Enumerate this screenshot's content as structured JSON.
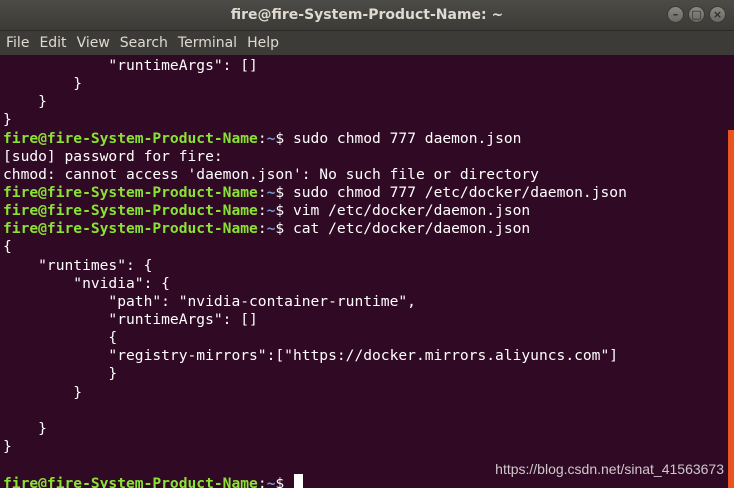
{
  "window": {
    "title": "fire@fire-System-Product-Name: ~",
    "buttons": [
      "close-icon",
      "minimize-icon",
      "maximize-icon"
    ]
  },
  "menu": [
    "File",
    "Edit",
    "View",
    "Search",
    "Terminal",
    "Help"
  ],
  "terminal": {
    "lines": [
      {
        "type": "text",
        "text": "            \"runtimeArgs\": []"
      },
      {
        "type": "text",
        "text": "        }"
      },
      {
        "type": "text",
        "text": "    }"
      },
      {
        "type": "text",
        "text": "}"
      },
      {
        "type": "cmd",
        "user": "fire@fire-System-Product-Name",
        "path": "~",
        "sym": "$ ",
        "cmd": "sudo chmod 777 daemon.json"
      },
      {
        "type": "text",
        "text": "[sudo] password for fire:"
      },
      {
        "type": "text",
        "text": "chmod: cannot access 'daemon.json': No such file or directory"
      },
      {
        "type": "cmd",
        "user": "fire@fire-System-Product-Name",
        "path": "~",
        "sym": "$ ",
        "cmd": "sudo chmod 777 /etc/docker/daemon.json"
      },
      {
        "type": "cmd",
        "user": "fire@fire-System-Product-Name",
        "path": "~",
        "sym": "$ ",
        "cmd": "vim /etc/docker/daemon.json"
      },
      {
        "type": "cmd",
        "user": "fire@fire-System-Product-Name",
        "path": "~",
        "sym": "$ ",
        "cmd": "cat /etc/docker/daemon.json"
      },
      {
        "type": "text",
        "text": "{"
      },
      {
        "type": "text",
        "text": "    \"runtimes\": {"
      },
      {
        "type": "text",
        "text": "        \"nvidia\": {"
      },
      {
        "type": "text",
        "text": "            \"path\": \"nvidia-container-runtime\","
      },
      {
        "type": "text",
        "text": "            \"runtimeArgs\": []"
      },
      {
        "type": "text",
        "text": "            {"
      },
      {
        "type": "text",
        "text": "            \"registry-mirrors\":[\"https://docker.mirrors.aliyuncs.com\"]"
      },
      {
        "type": "text",
        "text": "            }"
      },
      {
        "type": "text",
        "text": "        }"
      },
      {
        "type": "text",
        "text": ""
      },
      {
        "type": "text",
        "text": "    }"
      },
      {
        "type": "text",
        "text": "}"
      },
      {
        "type": "text",
        "text": ""
      },
      {
        "type": "cmd",
        "user": "fire@fire-System-Product-Name",
        "path": "~",
        "sym": "$ ",
        "cmd": "",
        "cursor": true
      }
    ]
  },
  "watermark": "https://blog.csdn.net/sinat_41563673",
  "colors": {
    "background": "#300a24",
    "prompt_user": "#8ae234",
    "prompt_path": "#729fcf",
    "scrollbar": "#e95420"
  }
}
